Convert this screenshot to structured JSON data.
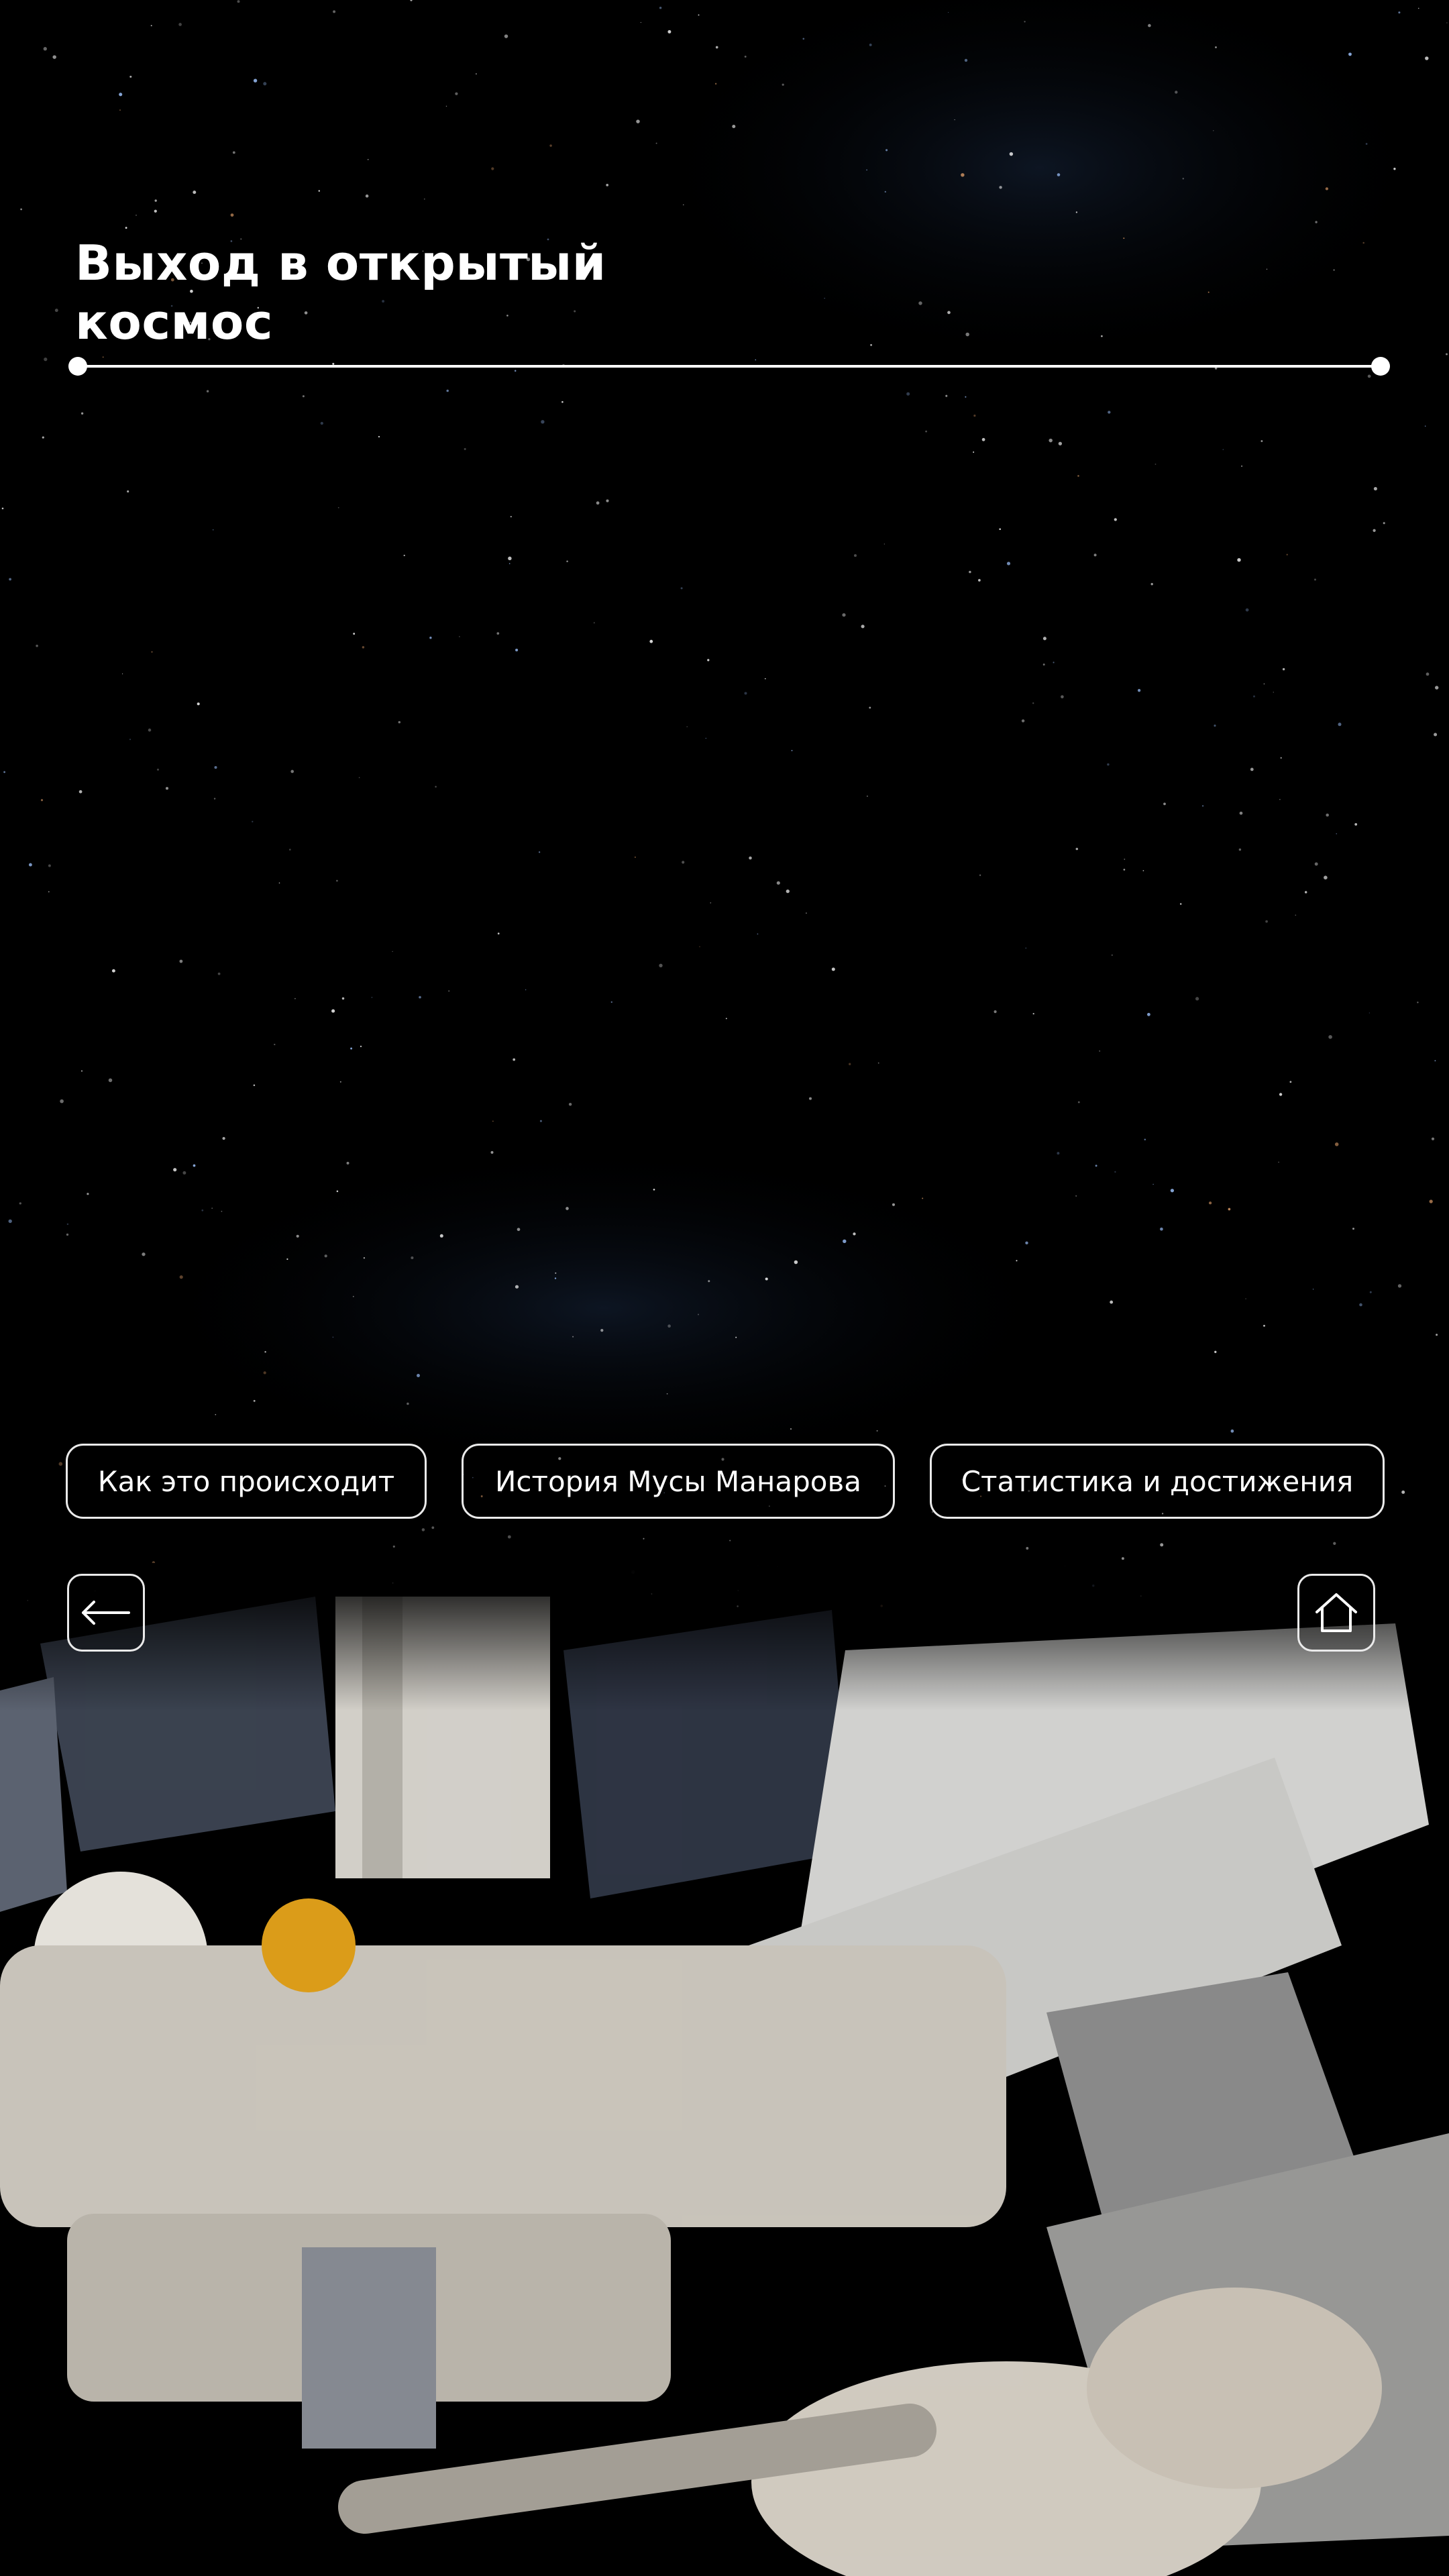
{
  "title": {
    "line1": "Выход в открытый",
    "line2": "космос"
  },
  "progress": {
    "fraction": 1.0
  },
  "tabs": [
    {
      "label": "Как это происходит"
    },
    {
      "label": "История Мусы Манарова"
    },
    {
      "label": "Статистика и достижения"
    }
  ],
  "controls": {
    "back_icon": "arrow-left-icon",
    "home_icon": "home-icon"
  },
  "colors": {
    "background": "#000000",
    "accent": "#ffffff",
    "border": "#eaeaea"
  }
}
